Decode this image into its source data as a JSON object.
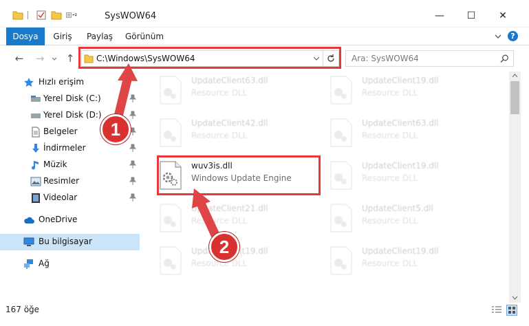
{
  "window": {
    "title": "SysWOW64",
    "minimize": "—",
    "maximize": "☐",
    "close": "✕"
  },
  "ribbon": {
    "tabs": [
      {
        "label": "Dosya",
        "active": true
      },
      {
        "label": "Giriş"
      },
      {
        "label": "Paylaş"
      },
      {
        "label": "Görünüm"
      }
    ],
    "expand_icon": "chevron-down-icon",
    "help": "?"
  },
  "address": {
    "path": "C:\\Windows\\SysWOW64",
    "search_placeholder": "Ara: SysWOW64"
  },
  "sidebar": {
    "items": [
      {
        "label": "Hızlı erişim",
        "icon": "star-icon"
      },
      {
        "label": "Yerel Disk (C:)",
        "icon": "drive-icon",
        "pinned": true
      },
      {
        "label": "Yerel Disk (D:)",
        "icon": "drive-icon",
        "pinned": true
      },
      {
        "label": "Belgeler",
        "icon": "document-icon",
        "pinned": true
      },
      {
        "label": "İndirmeler",
        "icon": "download-icon",
        "pinned": true
      },
      {
        "label": "Müzik",
        "icon": "music-icon",
        "pinned": true
      },
      {
        "label": "Resimler",
        "icon": "pictures-icon",
        "pinned": true
      },
      {
        "label": "Videolar",
        "icon": "video-icon",
        "pinned": true
      },
      {
        "label": "OneDrive",
        "icon": "cloud-icon"
      },
      {
        "label": "Bu bilgisayar",
        "icon": "computer-icon",
        "selected": true
      },
      {
        "label": "Ağ",
        "icon": "network-icon"
      }
    ]
  },
  "files": {
    "left": [
      {
        "name": "UpdateClient63.dll",
        "type": "Resource DLL"
      },
      {
        "name": "UpdateClient42.dll",
        "type": "Resource DLL"
      },
      {
        "name": "wuv3is.dll",
        "type": "Windows Update Engine"
      },
      {
        "name": "UpdateClient21.dll",
        "type": "Resource DLL"
      },
      {
        "name": "UpdateClient19.dll",
        "type": "Resource DLL"
      }
    ],
    "right": [
      {
        "name": "UpdateClient19.dll",
        "type": "Resource DLL"
      },
      {
        "name": "UpdateClient63.dll",
        "type": "Resource DLL"
      },
      {
        "name": "UpdateClient19.dll",
        "type": "Resource DLL"
      },
      {
        "name": "UpdateClient5.dll",
        "type": "Resource DLL"
      },
      {
        "name": "UpdateClient19.dll",
        "type": "Resource DLL"
      }
    ]
  },
  "status": {
    "item_count": "167 öğe"
  },
  "annotations": {
    "step1": "1",
    "step2": "2"
  },
  "colors": {
    "accent": "#1979ca",
    "highlight": "#e53939",
    "selected": "#cce4f7"
  }
}
